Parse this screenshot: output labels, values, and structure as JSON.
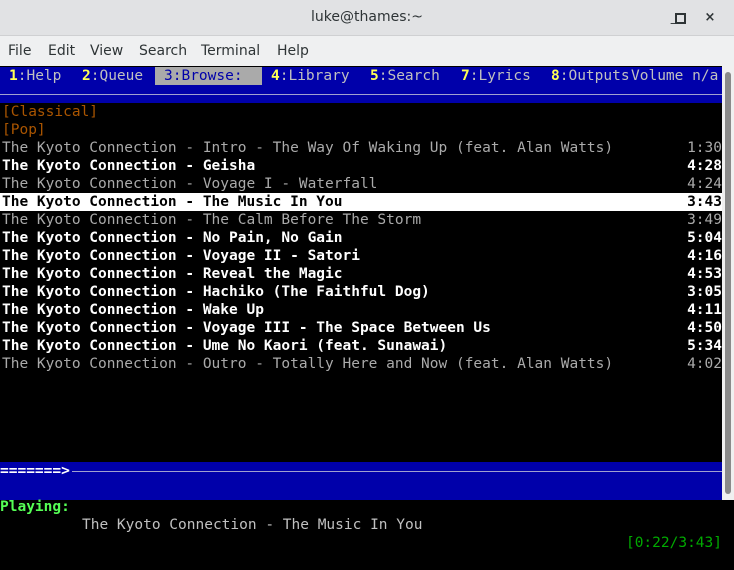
{
  "window": {
    "title": "luke@thames:~",
    "controls": {
      "minimize": "_",
      "maximize": "□",
      "close": "×"
    }
  },
  "menubar": [
    "File",
    "Edit",
    "View",
    "Search",
    "Terminal",
    "Help"
  ],
  "tabs": [
    {
      "key": "1",
      "label": ":Help"
    },
    {
      "key": "2",
      "label": ":Queue"
    },
    {
      "key": "3",
      "label": ":Browse:  ",
      "active": true
    },
    {
      "key": "4",
      "label": ":Library"
    },
    {
      "key": "5",
      "label": ":Search"
    },
    {
      "key": "7",
      "label": ":Lyrics"
    },
    {
      "key": "8",
      "label": ":Outputs"
    }
  ],
  "volume": "Volume n/a",
  "categories": [
    "[Classical]",
    "[Pop]"
  ],
  "tracks": [
    {
      "artist": "The Kyoto Connection",
      "sep": " - ",
      "title": "Intro - The Way Of Waking Up (feat. Alan Watts)",
      "duration": "1:30",
      "style": "dim"
    },
    {
      "artist": "The Kyoto Connection",
      "sep": " - ",
      "title": "Geisha",
      "duration": "4:28",
      "style": "bold"
    },
    {
      "artist": "The Kyoto Connection",
      "sep": " - ",
      "title": "Voyage I - Waterfall",
      "duration": "4:24",
      "style": "dim"
    },
    {
      "artist": "The Kyoto Connection",
      "sep": " - ",
      "title": "The Music In You",
      "duration": "3:43",
      "style": "sel"
    },
    {
      "artist": "The Kyoto Connection",
      "sep": " - ",
      "title": "The Calm Before The Storm",
      "duration": "3:49",
      "style": "dim"
    },
    {
      "artist": "The Kyoto Connection",
      "sep": " - ",
      "title": "No Pain, No Gain",
      "duration": "5:04",
      "style": "bold"
    },
    {
      "artist": "The Kyoto Connection",
      "sep": " - ",
      "title": "Voyage II - Satori",
      "duration": "4:16",
      "style": "bold"
    },
    {
      "artist": "The Kyoto Connection",
      "sep": " - ",
      "title": "Reveal the Magic",
      "duration": "4:53",
      "style": "bold"
    },
    {
      "artist": "The Kyoto Connection",
      "sep": " - ",
      "title": "Hachiko (The Faithful Dog)",
      "duration": "3:05",
      "style": "bold"
    },
    {
      "artist": "The Kyoto Connection",
      "sep": " - ",
      "title": "Wake Up",
      "duration": "4:11",
      "style": "bold"
    },
    {
      "artist": "The Kyoto Connection",
      "sep": " - ",
      "title": "Voyage III - The Space Between Us",
      "duration": "4:50",
      "style": "bold"
    },
    {
      "artist": "The Kyoto Connection",
      "sep": " - ",
      "title": "Ume No Kaori (feat. Sunawai)",
      "duration": "5:34",
      "style": "bold"
    },
    {
      "artist": "The Kyoto Connection",
      "sep": " - ",
      "title": "Outro - Totally Here and Now (feat. Alan Watts)",
      "duration": "4:02",
      "style": "dim"
    }
  ],
  "progress": {
    "bar_text": "=======>",
    "fraction": 0.099
  },
  "status": {
    "label": "Playing:",
    "now_playing": "The Kyoto Connection - The Music In You",
    "time": "[0:22/3:43]"
  }
}
